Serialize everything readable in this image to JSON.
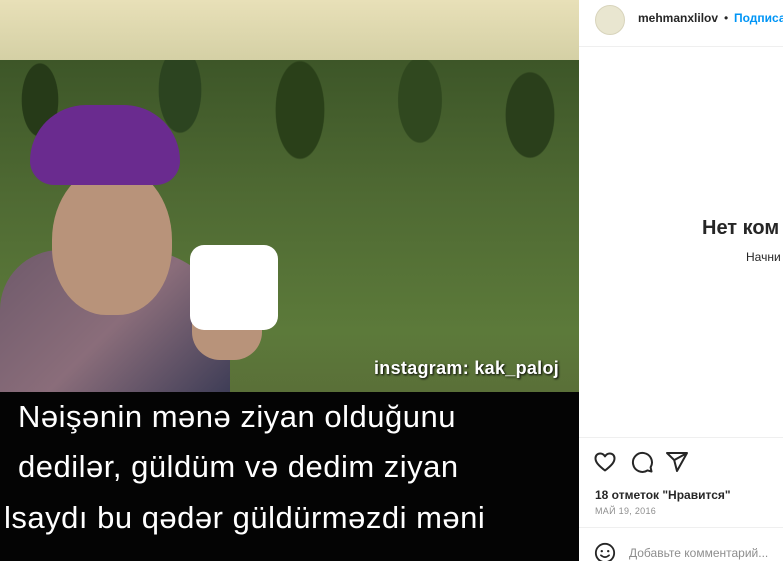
{
  "post": {
    "watermark": "instagram: kak_paloj",
    "caption_lines": [
      "Nəişənin mənə ziyan olduğunu",
      "dedilər, güldüm və dedim ziyan",
      "lsaydı bu qədər güldürməzdi məni"
    ]
  },
  "sidebar": {
    "username": "mehmanxlilov",
    "separator": "•",
    "follow_label": "Подписа",
    "empty_title": "Нет ком",
    "empty_subtitle": "Начни",
    "likes": "18 отметок \"Нравится\"",
    "date": "МАЙ 19, 2016",
    "comment_placeholder": "Добавьте комментарий..."
  },
  "icons": [
    "heart-icon",
    "comment-icon",
    "share-icon",
    "emoji-icon"
  ],
  "colors": {
    "accent": "#0095f6",
    "text": "#262626",
    "muted": "#8e8e8e"
  }
}
